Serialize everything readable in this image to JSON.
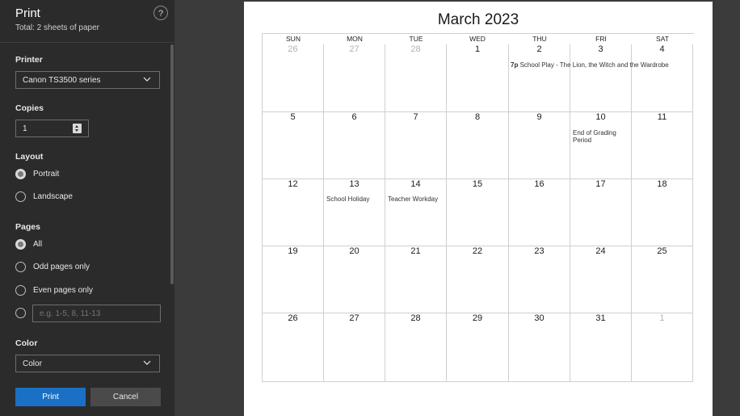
{
  "panel": {
    "title": "Print",
    "subtitle": "Total: 2 sheets of paper",
    "help": "?",
    "printer_label": "Printer",
    "printer_value": "Canon TS3500 series",
    "copies_label": "Copies",
    "copies_value": "1",
    "layout_label": "Layout",
    "layout_options": [
      "Portrait",
      "Landscape"
    ],
    "pages_label": "Pages",
    "pages_options": [
      "All",
      "Odd pages only",
      "Even pages only"
    ],
    "pages_custom_placeholder": "e.g. 1-5, 8, 11-13",
    "color_label": "Color",
    "color_value": "Color",
    "print_button": "Print",
    "cancel_button": "Cancel"
  },
  "calendar": {
    "title": "March 2023",
    "weekdays": [
      "SUN",
      "MON",
      "TUE",
      "WED",
      "THU",
      "FRI",
      "SAT"
    ],
    "weeks": [
      [
        "26",
        "27",
        "28",
        "1",
        "2",
        "3",
        "4"
      ],
      [
        "5",
        "6",
        "7",
        "8",
        "9",
        "10",
        "11"
      ],
      [
        "12",
        "13",
        "14",
        "15",
        "16",
        "17",
        "18"
      ],
      [
        "19",
        "20",
        "21",
        "22",
        "23",
        "24",
        "25"
      ],
      [
        "26",
        "27",
        "28",
        "29",
        "30",
        "31",
        "1"
      ]
    ],
    "events": {
      "play_time": "7p",
      "play_text": "School Play - The Lion, the Witch and the Wardrobe",
      "grading_line1": "End of Grading",
      "grading_line2": "Period",
      "holiday": "School Holiday",
      "workday": "Teacher Workday"
    }
  },
  "colors": {
    "panel_bg": "#2b2b2b",
    "primary_button": "#1a70c4",
    "outside_month_day": "#b3b3b3"
  }
}
